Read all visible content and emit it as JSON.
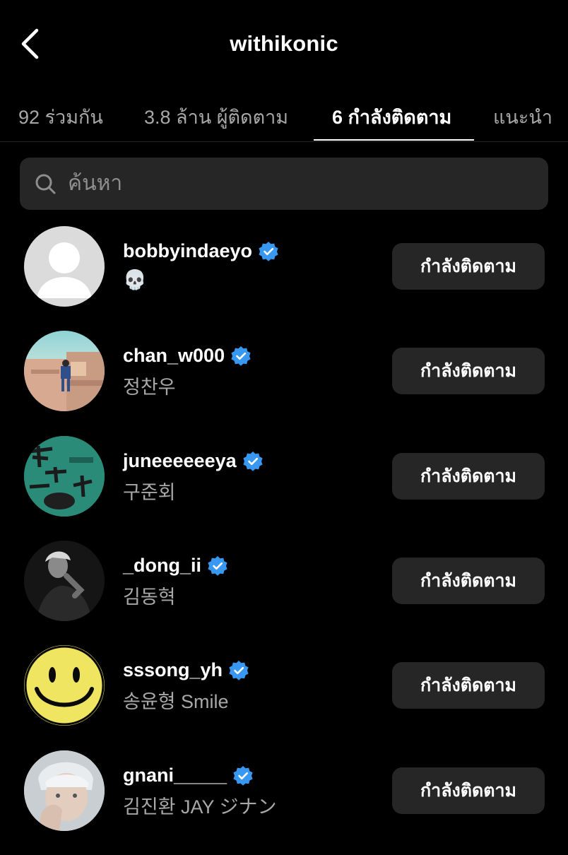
{
  "header": {
    "title": "withikonic"
  },
  "tabs": [
    {
      "label": "92 ร่วมกัน"
    },
    {
      "label": "3.8 ล้าน ผู้ติดตาม"
    },
    {
      "label": "6 กำลังติดตาม"
    },
    {
      "label": "แนะนำ"
    }
  ],
  "active_tab": "6 กำลังติดตาม",
  "search": {
    "placeholder": "ค้นหา",
    "value": ""
  },
  "accent_color": "#3897f0",
  "accounts": [
    {
      "username": "bobbyindaeyo",
      "full_name": "💀",
      "verified": true,
      "button": "กำลังติดตาม"
    },
    {
      "username": "chan_w000",
      "full_name": "정찬우",
      "verified": true,
      "button": "กำลังติดตาม"
    },
    {
      "username": "juneeeeeeya",
      "full_name": "구준회",
      "verified": true,
      "button": "กำลังติดตาม"
    },
    {
      "username": "_dong_ii",
      "full_name": "김동혁",
      "verified": true,
      "button": "กำลังติดตาม"
    },
    {
      "username": "sssong_yh",
      "full_name": "송윤형 Smile",
      "verified": true,
      "button": "กำลังติดตาม"
    },
    {
      "username": "gnani_____",
      "full_name": "김진환 JAY ジナン",
      "verified": true,
      "button": "กำลังติดตาม"
    }
  ]
}
